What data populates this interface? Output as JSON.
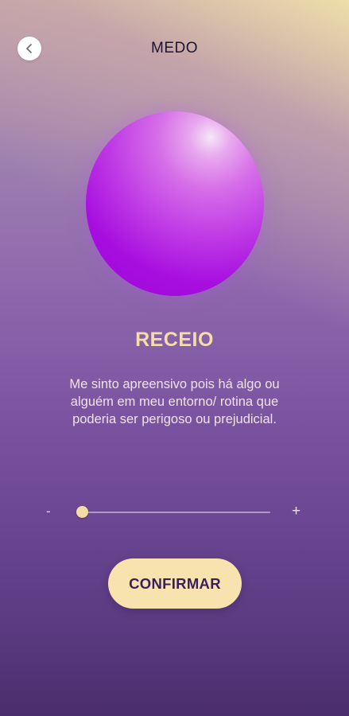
{
  "header": {
    "title": "MEDO",
    "back_icon": "chevron-left-icon"
  },
  "emotion": {
    "name": "RECEIO",
    "description": "Me sinto apreensivo pois há algo ou alguém em meu entorno/ rotina que poderia ser perigoso ou prejudicial.",
    "orb_color": "#b020e0"
  },
  "intensity_slider": {
    "min_label": "-",
    "max_label": "+",
    "value": 0
  },
  "actions": {
    "confirm_label": "CONFIRMAR"
  },
  "colors": {
    "accent": "#f8e3af",
    "title_text": "#1d1530",
    "button_text": "#3a1d5c"
  }
}
